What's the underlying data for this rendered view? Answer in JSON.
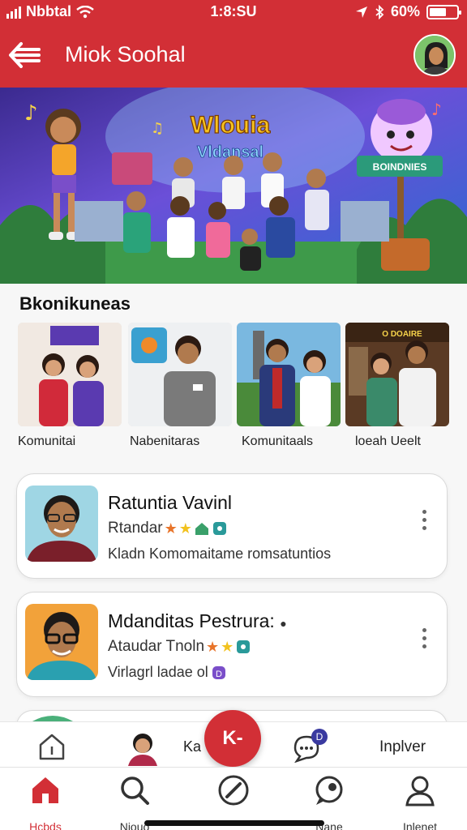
{
  "status": {
    "carrier": "Nbbtal",
    "time": "1:8:SU",
    "battery": "60%"
  },
  "header": {
    "title": "Miok Soohal"
  },
  "banner": {
    "line1": "Wlouia",
    "line2": "Vldansal",
    "sign": "BOINDNIES"
  },
  "section": {
    "title": "Bkonikuneas"
  },
  "tiles": [
    {
      "label": "Komunitai",
      "sign": ""
    },
    {
      "label": "Nabenitaras"
    },
    {
      "label": "Komunitaals"
    },
    {
      "label": "loeah Ueelt",
      "sign": "O DOAIRE"
    }
  ],
  "cards": [
    {
      "name": "Ratuntia Vavinl",
      "sub": "Rtandar",
      "desc": "Kladn Komomaitame romsatuntios"
    },
    {
      "name": "Mdanditas Pestrura:",
      "sub": "Ataudar Tnoln",
      "desc": "Virlagrl ladae ol"
    }
  ],
  "quickbar": {
    "left_label": "Ka",
    "fab_label": "K-",
    "right_label": "Inplver",
    "badge": "D"
  },
  "tabs": [
    {
      "label": "Hcbds",
      "icon": "home-icon"
    },
    {
      "label": "Niouo",
      "icon": "search-icon"
    },
    {
      "label": "",
      "icon": "pencil-icon"
    },
    {
      "label": "Nane",
      "icon": "chat-icon"
    },
    {
      "label": "Inlenet",
      "icon": "profile-icon"
    }
  ],
  "colors": {
    "primary": "#d22f36",
    "text": "#111111"
  }
}
